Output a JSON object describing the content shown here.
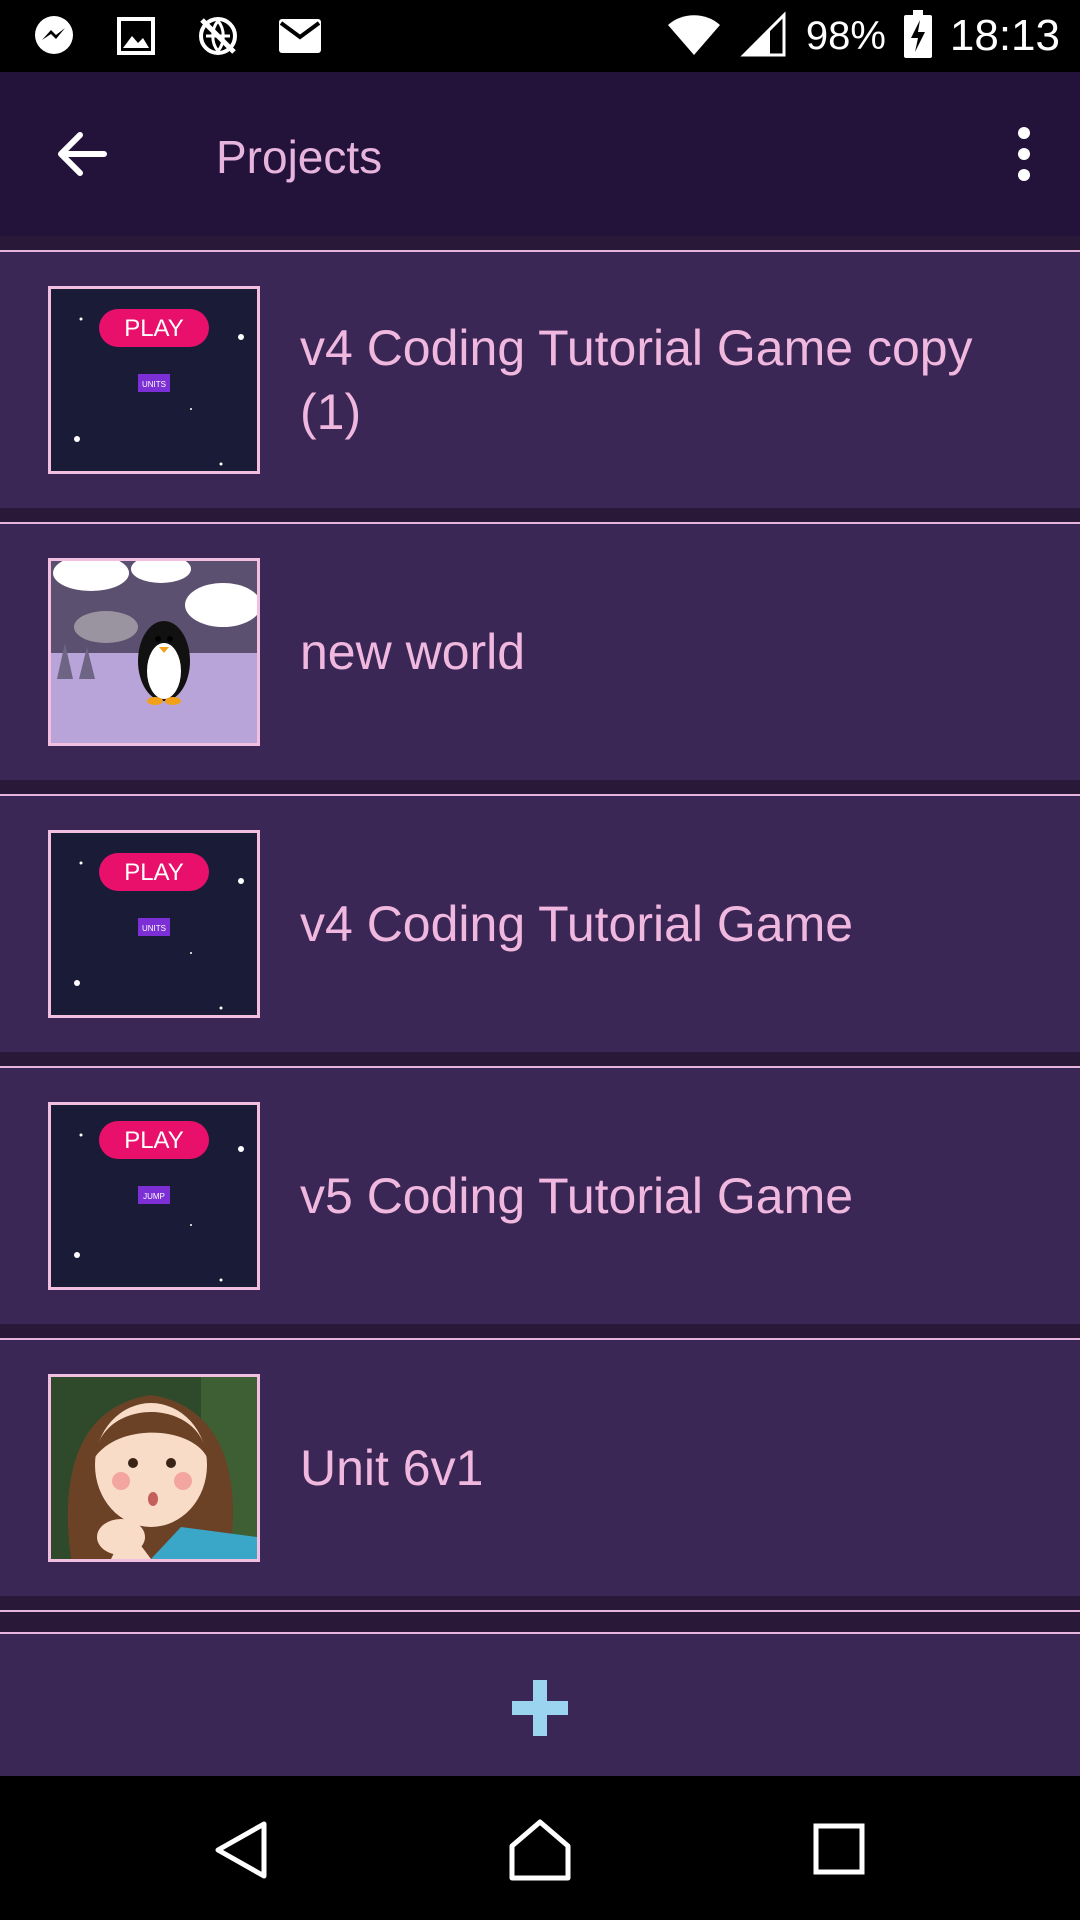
{
  "status_bar": {
    "icons_left": [
      "messenger-icon",
      "gallery-icon",
      "no-sync-icon",
      "mail-icon"
    ],
    "battery": "98%",
    "time": "18:13"
  },
  "app_bar": {
    "title": "Projects"
  },
  "projects": [
    {
      "title": "v4 Coding Tutorial Game copy (1)",
      "thumb_play": "PLAY",
      "thumb_tag": "UNITS"
    },
    {
      "title": "new world"
    },
    {
      "title": "v4 Coding Tutorial Game",
      "thumb_play": "PLAY",
      "thumb_tag": "UNITS"
    },
    {
      "title": "v5 Coding Tutorial Game",
      "thumb_play": "PLAY",
      "thumb_tag": "JUMP"
    },
    {
      "title": "Unit 6v1"
    }
  ],
  "colors": {
    "accent_text": "#f0b8de",
    "list_bg": "#3b2756",
    "app_bar_bg": "#23133b",
    "add_icon": "#9ad4ee"
  }
}
